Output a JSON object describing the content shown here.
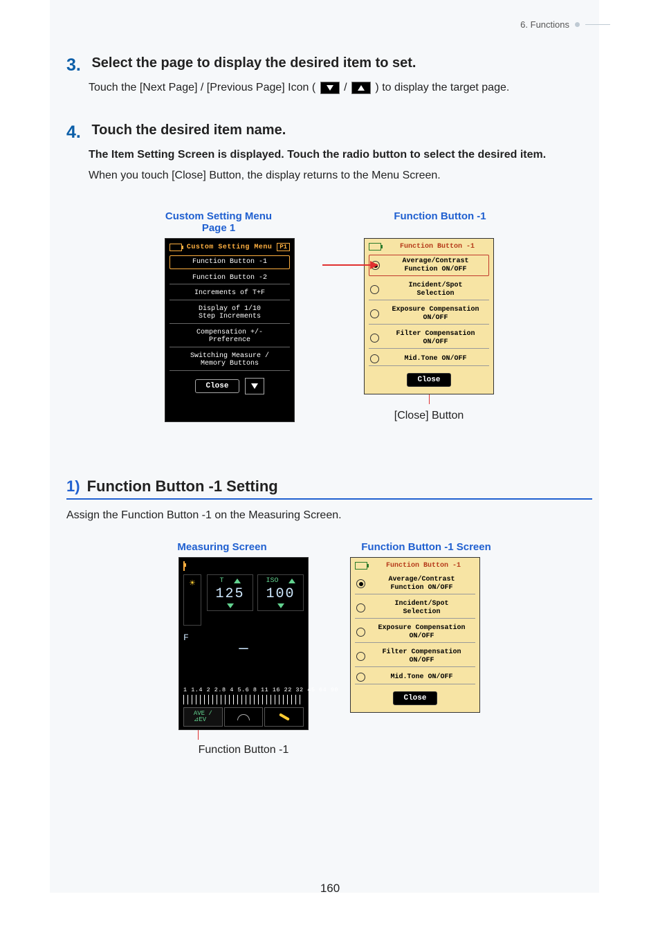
{
  "header": {
    "chapter": "6.  Functions"
  },
  "steps": [
    {
      "num": "3.",
      "title": "Select the page to display the desired item to set.",
      "body_before": "Touch the [Next Page] / [Previous Page] Icon ( ",
      "body_after": " ) to display the target page."
    },
    {
      "num": "4.",
      "title": "Touch the desired item name.",
      "bold": "The Item Setting Screen is displayed. Touch the radio button to select the desired item.",
      "body": "When you touch [Close] Button, the display returns to the Menu Screen."
    }
  ],
  "captions_row1": {
    "left": "Custom Setting Menu\nPage 1",
    "right": "Function Button -1"
  },
  "custom_menu": {
    "title": "Custom Setting Menu",
    "page_badge": "P1",
    "items": [
      "Function Button -1",
      "Function Button -2",
      "Increments of T+F",
      "Display of 1/10\nStep Increments",
      "Compensation +/-\nPreference",
      "Switching Measure /\nMemory Buttons"
    ],
    "close": "Close"
  },
  "function_panel": {
    "title": "Function Button -1",
    "options": [
      "Average/Contrast\nFunction ON/OFF",
      "Incident/Spot\nSelection",
      "Exposure Compensation\nON/OFF",
      "Filter Compensation\nON/OFF",
      "Mid.Tone ON/OFF"
    ],
    "selected_index": 0,
    "close": "Close"
  },
  "close_label": "[Close] Button",
  "section": {
    "num": "1)",
    "title": "Function Button -1 Setting",
    "body": "Assign the Function Button -1 on the Measuring Screen."
  },
  "captions_row2": {
    "left": "Measuring Screen",
    "right": "Function Button -1 Screen"
  },
  "measuring": {
    "label_t": "T",
    "label_iso": "ISO",
    "val_t": "125",
    "val_iso": "100",
    "f_label": "F",
    "dash": "—",
    "scale": "1 1.4 2 2.8 4 5.6 8 11 16 22 32 45 64 90",
    "footer_ave": "AVE /\n⊿EV"
  },
  "below_meas": "Function Button -1",
  "page_number": "160"
}
